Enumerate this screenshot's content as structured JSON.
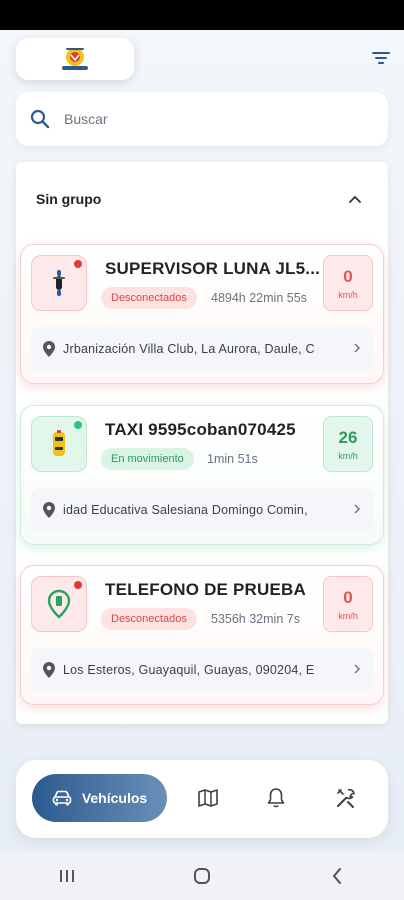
{
  "search": {
    "placeholder": "Buscar"
  },
  "group": {
    "title": "Sin grupo"
  },
  "vehicles": [
    {
      "name": "SUPERVISOR LUNA JL5...",
      "status": "Desconectados",
      "duration": "4894h 22min 55s",
      "speed": "0",
      "speed_unit": "km/h",
      "address": "Jrbanización Villa Club, La Aurora, Daule, C",
      "icon": "motorcycle-icon",
      "state_color": "#e05555"
    },
    {
      "name": "TAXI 9595coban070425",
      "status": "En movimiento",
      "duration": "1min 51s",
      "speed": "26",
      "speed_unit": "km/h",
      "address": "idad Educativa Salesiana Domingo Comin, ",
      "icon": "taxi-car-icon",
      "state_color": "#2e9a5c"
    },
    {
      "name": "TELEFONO DE PRUEBA",
      "status": "Desconectados",
      "duration": "5356h 32min 7s",
      "speed": "0",
      "speed_unit": "km/h",
      "address": "Los Esteros, Guayaquil, Guayas, 090204, E",
      "icon": "phone-location-icon",
      "state_color": "#e05555"
    }
  ],
  "nav": {
    "vehicles_label": "Vehículos"
  },
  "colors": {
    "accent": "#2c5a8e",
    "offline": "#e05555",
    "online": "#2e9a5c"
  }
}
